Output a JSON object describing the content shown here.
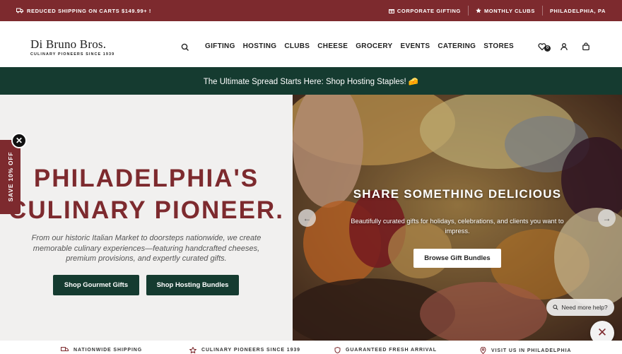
{
  "topbar": {
    "shipping": "REDUCED SHIPPING ON CARTS $149.99+ !",
    "corporate": "CORPORATE GIFTING",
    "monthly": "MONTHLY CLUBS",
    "location": "PHILADELPHIA, PA"
  },
  "brand": {
    "name": "Di Bruno Bros.",
    "tagline": "CULINARY PIONEERS SINCE 1939"
  },
  "nav": [
    "GIFTING",
    "HOSTING",
    "CLUBS",
    "CHEESE",
    "GROCERY",
    "EVENTS",
    "CATERING",
    "STORES"
  ],
  "header": {
    "wishlist_count": "0"
  },
  "promo": {
    "text": "The Ultimate Spread Starts Here: Shop Hosting Staples! 🧀"
  },
  "hero": {
    "title_line1": "PHILADELPHIA'S",
    "title_line2": "CULINARY PIONEER.",
    "subtitle": "From our historic Italian Market to doorsteps nationwide, we create memorable culinary experiences—featuring handcrafted cheeses, premium provisions, and expertly curated gifts.",
    "btn1": "Shop Gourmet Gifts",
    "btn2": "Shop Hosting Bundles"
  },
  "slide": {
    "title": "SHARE SOMETHING DELICIOUS",
    "subtitle": "Beautifully curated gifts for holidays, celebrations, and clients you want to impress.",
    "button": "Browse Gift Bundles"
  },
  "side_tab": {
    "label": "SAVE 10% OFF"
  },
  "help": {
    "label": "Need more help?"
  },
  "features": [
    "NATIONWIDE SHIPPING",
    "CULINARY PIONEERS SINCE 1939",
    "GUARANTEED FRESH ARRIVAL",
    "VISIT US IN PHILADELPHIA"
  ],
  "colors": {
    "brand_red": "#7d2a2e",
    "brand_green": "#153b30"
  }
}
